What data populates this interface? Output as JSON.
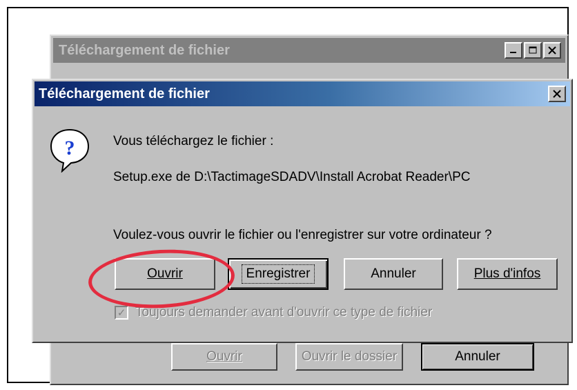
{
  "back_window": {
    "title": "Téléchargement de fichier",
    "buttons": {
      "open": "Ouvrir",
      "open_folder": "Ouvrir le dossier",
      "cancel": "Annuler"
    }
  },
  "dialog": {
    "title": "Téléchargement de fichier",
    "message_line1": "Vous téléchargez le fichier :",
    "file_line": "Setup.exe de D:\\TactimageSDADV\\Install Acrobat Reader\\PC",
    "question": "Voulez-vous ouvrir le fichier ou l'enregistrer sur votre ordinateur ?",
    "buttons": {
      "open": "Ouvrir",
      "save": "Enregistrer",
      "cancel": "Annuler",
      "more_info": "Plus d'infos"
    },
    "checkbox_label": "Toujours demander avant d'ouvrir ce type de fichier",
    "checkbox_checked": true
  },
  "colors": {
    "highlight_circle": "#e32c3f",
    "title_active_start": "#0a246a",
    "title_active_end": "#a6caf0",
    "title_inactive": "#808080"
  },
  "icons": {
    "question": "question-icon",
    "close": "close-icon",
    "minimize": "minimize-icon",
    "maximize": "maximize-icon"
  }
}
